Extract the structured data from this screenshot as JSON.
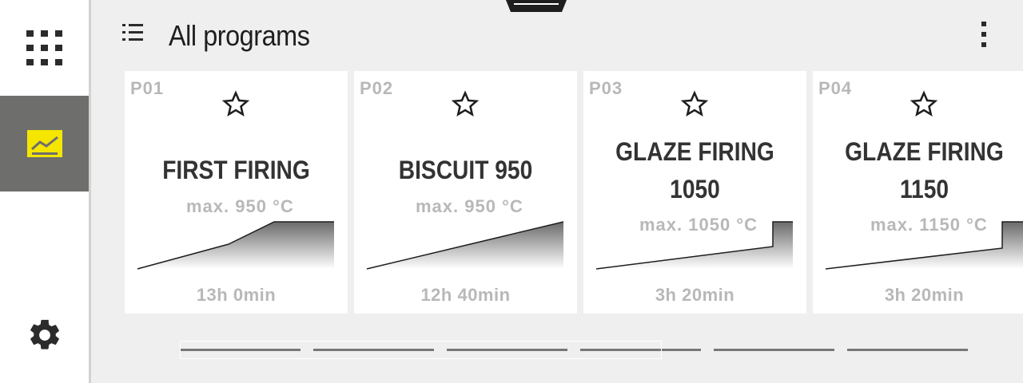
{
  "sidebar": {
    "items": [
      {
        "name": "apps",
        "icon": "grid-icon"
      },
      {
        "name": "programs",
        "icon": "chart-icon",
        "active": true
      },
      {
        "name": "settings",
        "icon": "gear-icon"
      }
    ],
    "active_color": "#6e6e6c",
    "accent_color": "#f5e600"
  },
  "header": {
    "title": "All programs",
    "list_icon": "list-icon",
    "menu_icon": "more-vertical-icon"
  },
  "programs": [
    {
      "number": "P01",
      "name_line1": "FIRST FIRING",
      "name_line2": "",
      "max": "max. 950 °C",
      "duration": "13h 0min",
      "favorite": false
    },
    {
      "number": "P02",
      "name_line1": "BISCUIT 950",
      "name_line2": "",
      "max": "max. 950 °C",
      "duration": "12h 40min",
      "favorite": false
    },
    {
      "number": "P03",
      "name_line1": "GLAZE FIRING",
      "name_line2": "1050",
      "max": "max. 1050 °C",
      "duration": "3h 20min",
      "favorite": false
    },
    {
      "number": "P04",
      "name_line1": "GLAZE FIRING",
      "name_line2": "1150",
      "max": "max. 1150 °C",
      "duration": "3h 20min",
      "favorite": false
    }
  ],
  "pagination": {
    "pages": 6,
    "visible_window_pages": 4
  }
}
